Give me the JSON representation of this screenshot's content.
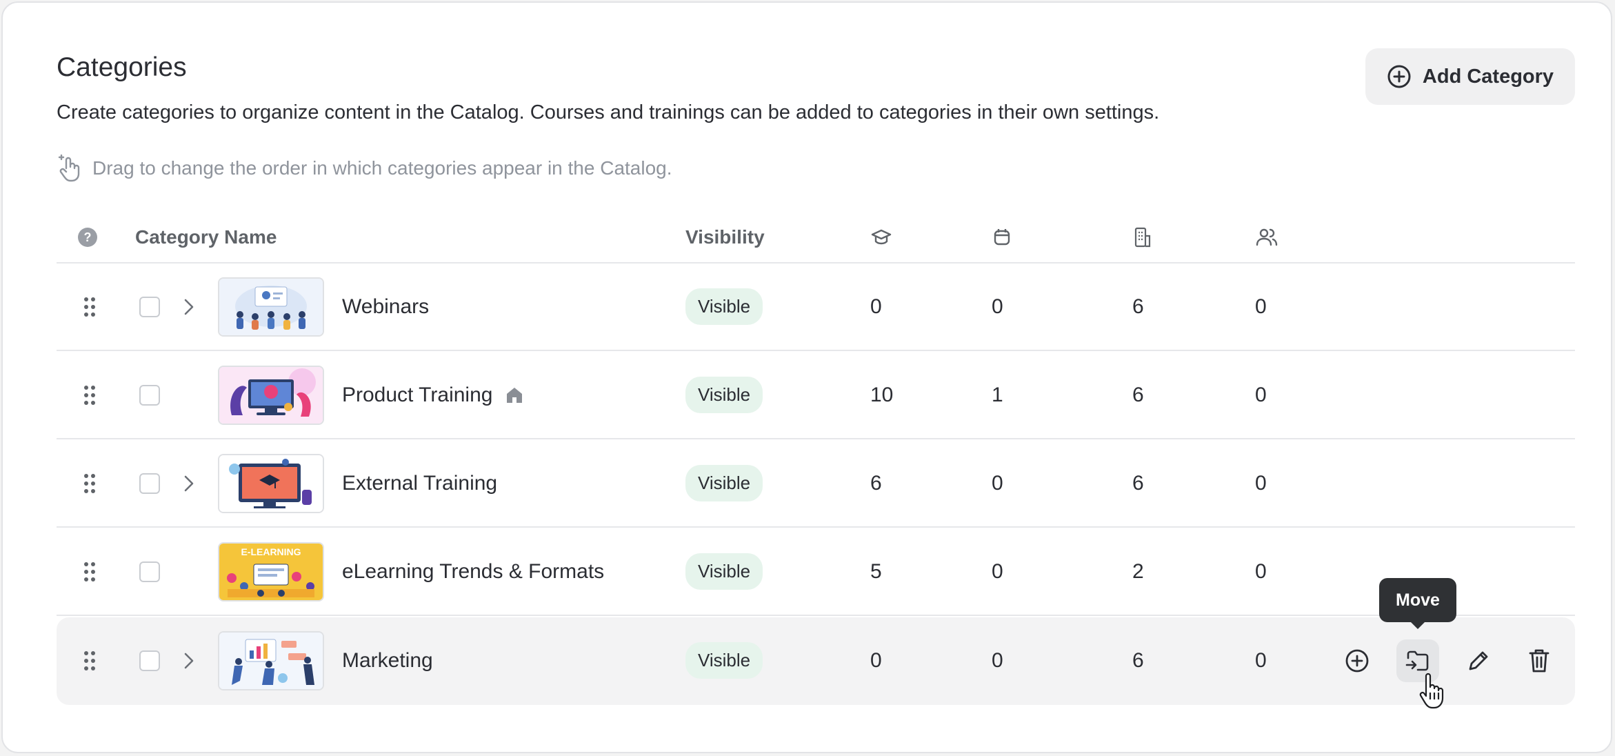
{
  "page": {
    "title": "Categories",
    "description": "Create categories to organize content in the Catalog. Courses and trainings can be added to categories in their own settings.",
    "hint": "Drag to change the order in which categories appear in the Catalog.",
    "add_button_label": "Add Category"
  },
  "table": {
    "headers": {
      "help_icon": "question-circle-icon",
      "name": "Category Name",
      "visibility": "Visibility",
      "col1_icon": "graduation-cap-icon",
      "col2_icon": "calendar-icon",
      "col3_icon": "building-icon",
      "col4_icon": "users-icon"
    },
    "rows": [
      {
        "name": "Webinars",
        "visibility": "Visible",
        "c1": "0",
        "c2": "0",
        "c3": "6",
        "c4": "0",
        "has_children": true,
        "home": false
      },
      {
        "name": "Product Training",
        "visibility": "Visible",
        "c1": "10",
        "c2": "1",
        "c3": "6",
        "c4": "0",
        "has_children": false,
        "home": true
      },
      {
        "name": "External Training",
        "visibility": "Visible",
        "c1": "6",
        "c2": "0",
        "c3": "6",
        "c4": "0",
        "has_children": true,
        "home": false
      },
      {
        "name": "eLearning Trends & Formats",
        "visibility": "Visible",
        "c1": "5",
        "c2": "0",
        "c3": "2",
        "c4": "0",
        "has_children": false,
        "home": false,
        "thumb_text": "E-LEARNING"
      },
      {
        "name": "Marketing",
        "visibility": "Visible",
        "c1": "0",
        "c2": "0",
        "c3": "6",
        "c4": "0",
        "has_children": true,
        "home": false
      }
    ]
  },
  "row_actions": {
    "add_icon": "plus-circle-icon",
    "move_icon": "move-folder-icon",
    "edit_icon": "pencil-icon",
    "delete_icon": "trash-icon",
    "tooltip": "Move"
  },
  "colors": {
    "badge_bg": "#e6f4ec",
    "hover_row_bg": "#f3f3f4",
    "tooltip_bg": "#2f3134"
  }
}
